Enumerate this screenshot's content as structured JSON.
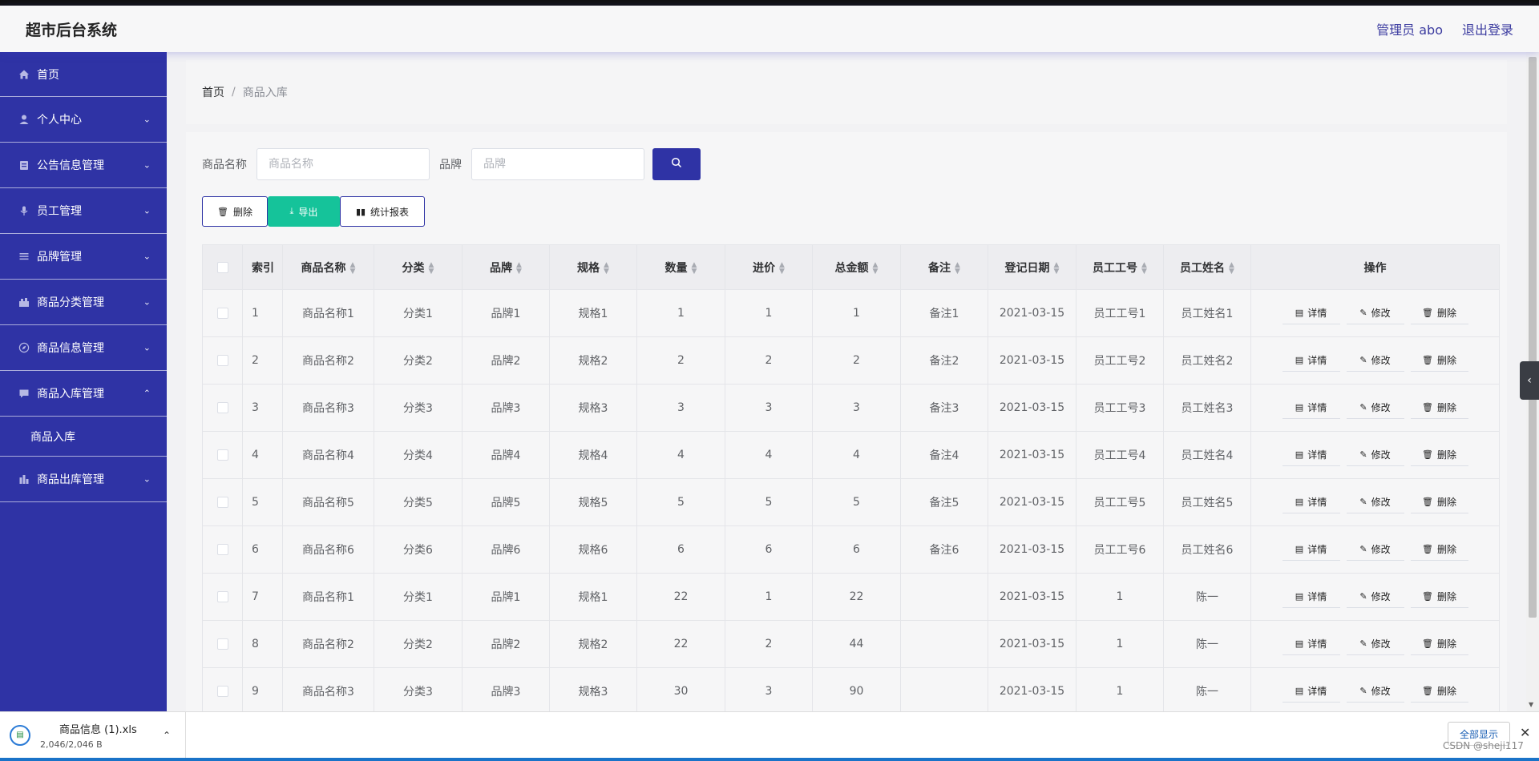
{
  "header": {
    "logo": "超市后台系统",
    "admin": "管理员 abo",
    "logout": "退出登录"
  },
  "sidebar": {
    "items": [
      {
        "label": "首页",
        "icon": "home-icon",
        "expandable": false
      },
      {
        "label": "个人中心",
        "icon": "user-icon",
        "expandable": true
      },
      {
        "label": "公告信息管理",
        "icon": "notice-icon",
        "expandable": true
      },
      {
        "label": "员工管理",
        "icon": "mic-icon",
        "expandable": true
      },
      {
        "label": "品牌管理",
        "icon": "list-icon",
        "expandable": true
      },
      {
        "label": "商品分类管理",
        "icon": "category-icon",
        "expandable": true
      },
      {
        "label": "商品信息管理",
        "icon": "compass-icon",
        "expandable": true
      },
      {
        "label": "商品入库管理",
        "icon": "chat-icon",
        "expandable": true,
        "expanded": true
      },
      {
        "label": "商品出库管理",
        "icon": "chart-icon",
        "expandable": true
      }
    ],
    "submenu_active": "商品入库"
  },
  "breadcrumb": {
    "home": "首页",
    "separator": "/",
    "current": "商品入库"
  },
  "search": {
    "name_label": "商品名称",
    "name_placeholder": "商品名称",
    "brand_label": "品牌",
    "brand_placeholder": "品牌"
  },
  "toolbar": {
    "delete_label": "删除",
    "export_label": "导出",
    "report_label": "统计报表"
  },
  "table": {
    "columns": [
      "索引",
      "商品名称",
      "分类",
      "品牌",
      "规格",
      "数量",
      "进价",
      "总金额",
      "备注",
      "登记日期",
      "员工工号",
      "员工姓名",
      "操作"
    ],
    "rows": [
      [
        "1",
        "商品名称1",
        "分类1",
        "品牌1",
        "规格1",
        "1",
        "1",
        "1",
        "备注1",
        "2021-03-15",
        "员工工号1",
        "员工姓名1"
      ],
      [
        "2",
        "商品名称2",
        "分类2",
        "品牌2",
        "规格2",
        "2",
        "2",
        "2",
        "备注2",
        "2021-03-15",
        "员工工号2",
        "员工姓名2"
      ],
      [
        "3",
        "商品名称3",
        "分类3",
        "品牌3",
        "规格3",
        "3",
        "3",
        "3",
        "备注3",
        "2021-03-15",
        "员工工号3",
        "员工姓名3"
      ],
      [
        "4",
        "商品名称4",
        "分类4",
        "品牌4",
        "规格4",
        "4",
        "4",
        "4",
        "备注4",
        "2021-03-15",
        "员工工号4",
        "员工姓名4"
      ],
      [
        "5",
        "商品名称5",
        "分类5",
        "品牌5",
        "规格5",
        "5",
        "5",
        "5",
        "备注5",
        "2021-03-15",
        "员工工号5",
        "员工姓名5"
      ],
      [
        "6",
        "商品名称6",
        "分类6",
        "品牌6",
        "规格6",
        "6",
        "6",
        "6",
        "备注6",
        "2021-03-15",
        "员工工号6",
        "员工姓名6"
      ],
      [
        "7",
        "商品名称1",
        "分类1",
        "品牌1",
        "规格1",
        "22",
        "1",
        "22",
        "",
        "2021-03-15",
        "1",
        "陈一"
      ],
      [
        "8",
        "商品名称2",
        "分类2",
        "品牌2",
        "规格2",
        "22",
        "2",
        "44",
        "",
        "2021-03-15",
        "1",
        "陈一"
      ],
      [
        "9",
        "商品名称3",
        "分类3",
        "品牌3",
        "规格3",
        "30",
        "3",
        "90",
        "",
        "2021-03-15",
        "1",
        "陈一"
      ]
    ],
    "row_actions": {
      "detail": "详情",
      "edit": "修改",
      "delete": "删除"
    }
  },
  "download": {
    "filename": "商品信息 (1).xls",
    "size": "2,046/2,046 B",
    "show_all": "全部显示"
  },
  "watermark": "CSDN @sheji117",
  "colors": {
    "primary": "#2f33a5",
    "export": "#15c39a"
  }
}
